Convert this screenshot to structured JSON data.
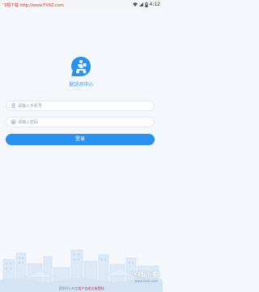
{
  "status_bar": {
    "left_text": "飞翔下载 http://www.FXXZ.com",
    "time": "4:12"
  },
  "app": {
    "title": "配送员中心",
    "logo_icon": "delivery-scooter-icon",
    "accent_color": "#2a92ee"
  },
  "form": {
    "phone_placeholder": "请输入手机号",
    "phone_value": "",
    "password_placeholder": "请输入密码",
    "password_value": "",
    "login_label": "登录"
  },
  "footer": {
    "text_prefix": "昆明开心外卖",
    "text_mark": "用户自助注册登陆"
  },
  "watermark": {
    "brand": "飞翔下载",
    "url": "www.fxxz.com"
  }
}
